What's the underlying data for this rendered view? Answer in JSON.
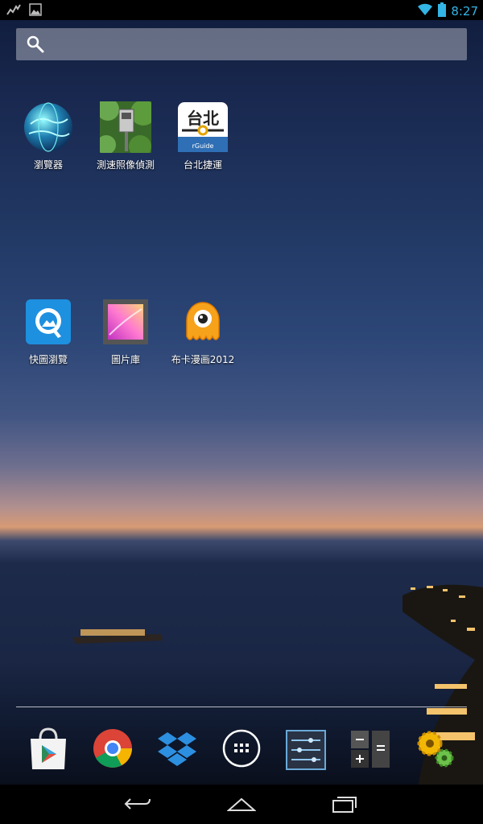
{
  "status_bar": {
    "time": "8:27",
    "left_icons": [
      "activity-icon",
      "gallery-notification-icon"
    ],
    "right_icons": [
      "wifi-icon",
      "battery-icon"
    ],
    "time_color": "#33b5e5"
  },
  "search": {
    "icon": "search-icon"
  },
  "apps_row1": [
    {
      "label": "瀏覽器",
      "icon": "globe-browser-icon"
    },
    {
      "label": "測速照像偵測",
      "icon": "speed-camera-icon"
    },
    {
      "label": "台北捷運",
      "icon": "taipei-metro-icon",
      "badge_text": "台北",
      "sub_text": "rGuide"
    }
  ],
  "apps_row2": [
    {
      "label": "快圖瀏覽",
      "icon": "quickpic-icon"
    },
    {
      "label": "圖片庫",
      "icon": "gallery-icon"
    },
    {
      "label": "布卡漫画2012",
      "icon": "buka-manga-icon"
    }
  ],
  "dock": [
    {
      "name": "play-store-icon"
    },
    {
      "name": "chrome-icon"
    },
    {
      "name": "dropbox-icon"
    },
    {
      "name": "app-drawer-icon"
    },
    {
      "name": "settings-sliders-icon"
    },
    {
      "name": "calculator-icon"
    },
    {
      "name": "settings-gears-icon"
    }
  ],
  "nav": [
    "back-icon",
    "home-icon",
    "recent-apps-icon"
  ],
  "colors": {
    "status_bg": "#000000",
    "accent": "#33b5e5"
  }
}
